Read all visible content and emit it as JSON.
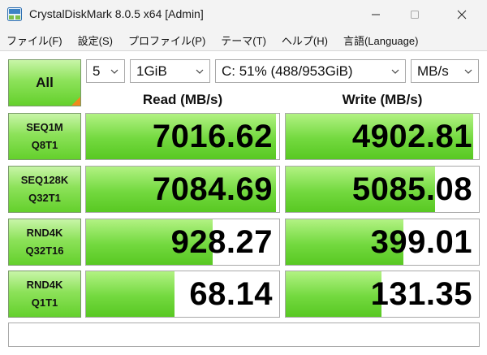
{
  "window": {
    "title": "CrystalDiskMark 8.0.5 x64 [Admin]",
    "icon": "crystaldiskmark-app-icon",
    "controls": [
      "minimize-icon",
      "maximize-icon",
      "close-icon"
    ]
  },
  "menu": [
    "ファイル(F)",
    "設定(S)",
    "プロファイル(P)",
    "テーマ(T)",
    "ヘルプ(H)",
    "言語(Language)"
  ],
  "controls": {
    "all_label": "All",
    "count": "5",
    "size": "1GiB",
    "drive": "C: 51% (488/953GiB)",
    "unit": "MB/s"
  },
  "columns": {
    "read": "Read (MB/s)",
    "write": "Write (MB/s)"
  },
  "tests": [
    {
      "line1": "SEQ1M",
      "line2": "Q8T1",
      "read": "7016.62",
      "write": "4902.81",
      "read_fill": 0.985,
      "write_fill": 0.97
    },
    {
      "line1": "SEQ128K",
      "line2": "Q32T1",
      "read": "7084.69",
      "write": "5085.08",
      "read_fill": 0.985,
      "write_fill": 0.775
    },
    {
      "line1": "RND4K",
      "line2": "Q32T16",
      "read": "928.27",
      "write": "399.01",
      "read_fill": 0.655,
      "write_fill": 0.61
    },
    {
      "line1": "RND4K",
      "line2": "Q1T1",
      "read": "68.14",
      "write": "131.35",
      "read_fill": 0.46,
      "write_fill": 0.495
    }
  ],
  "comment": "",
  "colors": {
    "accent_green": "#64d02c",
    "corner_orange": "#f08a1c"
  }
}
